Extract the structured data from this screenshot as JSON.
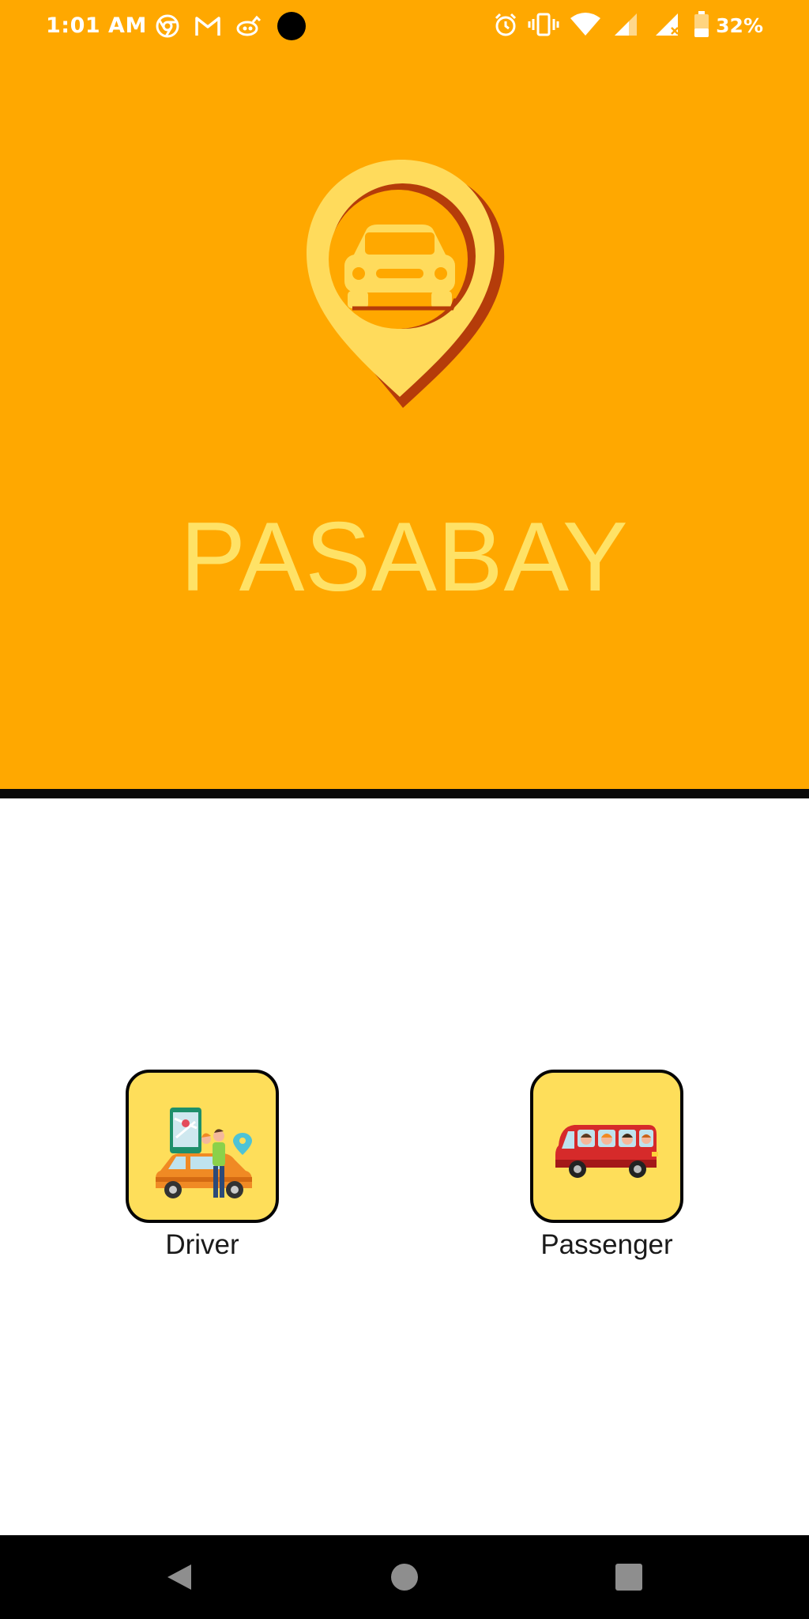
{
  "status_bar": {
    "time": "1:01 AM",
    "battery_text": "32%",
    "left_icons": [
      "chrome-icon",
      "gmail-icon",
      "app-notification-icon",
      "dot-icon"
    ],
    "right_icons": [
      "alarm-icon",
      "vibrate-icon",
      "wifi-icon",
      "signal-icon",
      "signal-no-service-icon",
      "battery-icon"
    ]
  },
  "header": {
    "logo_icon": "map-pin-car-icon",
    "app_name": "PASABAY"
  },
  "roles": {
    "driver": {
      "label": "Driver",
      "icon": "driver-car-icon"
    },
    "passenger": {
      "label": "Passenger",
      "icon": "passenger-van-icon"
    }
  },
  "nav_bar": {
    "back_icon": "back-triangle-icon",
    "home_icon": "home-circle-icon",
    "recent_icon": "recent-square-icon"
  },
  "colors": {
    "primary": "#FFA800",
    "title": "#FFE266",
    "tile_background": "#FEDE5A",
    "logo_fill": "#FFDB5C",
    "logo_shadow": "#B53C0A"
  }
}
